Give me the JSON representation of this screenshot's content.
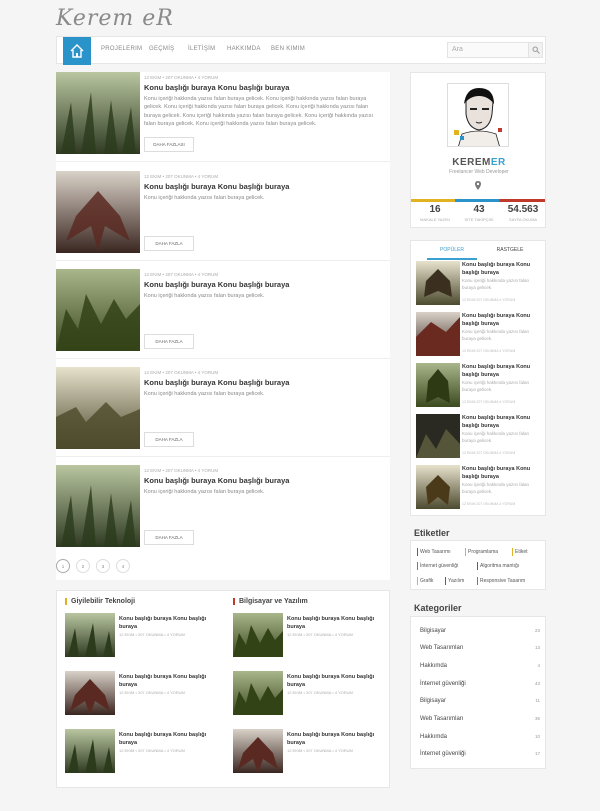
{
  "logo": "Kerem eR",
  "nav": {
    "items": [
      "PROJELERIM",
      "GEÇMİŞ",
      "İLETİŞİM",
      "HAKKIMDA",
      "BEN KIMIM"
    ],
    "search_placeholder": "Ara"
  },
  "posts": [
    {
      "meta": "12 EKIM  •  207 OKUNMA  •  4 YORUM",
      "title": "Konu başlığı buraya Konu başlığı buraya",
      "excerpt": "Konu içeriği hakkında yazısı falan buraya gelicek. Konu içeriği hakkında yazısı falan buraya gelicek. Konu içeriği hakkında yazısı falan buraya gelicek. Konu içeriği hakkında yazısı falan buraya gelicek. Konu içeriği hakkında yazısı falan buraya gelicek. Konu içeriği hakkında yazısı falan buraya gelicek. Konu içeriği hakkında yazısı falan buraya gelicek.",
      "button": "DAHA FAZLASI"
    },
    {
      "meta": "12 EKIM  •  207 OKUNMA  •  4 YORUM",
      "title": "Konu başlığı buraya Konu başlığı buraya",
      "excerpt": "Konu içeriği hakkında yazısı falan buraya gelicek.",
      "button": "DAHA FAZLA"
    },
    {
      "meta": "12 EKIM  •  207 OKUNMA  •  4 YORUM",
      "title": "Konu başlığı buraya Konu başlığı buraya",
      "excerpt": "Konu içeriği hakkında yazısı falan buraya gelicek.",
      "button": "DAHA FAZLA"
    },
    {
      "meta": "12 EKIM  •  207 OKUNMA  •  4 YORUM",
      "title": "Konu başlığı buraya Konu başlığı buraya",
      "excerpt": "Konu içeriği hakkında yazısı falan buraya gelicek.",
      "button": "DAHA FAZLA"
    },
    {
      "meta": "12 EKIM  •  207 OKUNMA  •  4 YORUM",
      "title": "Konu başlığı buraya Konu başlığı buraya",
      "excerpt": "Konu içeriği hakkında yazısı falan buraya gelicek.",
      "button": "DAHA FAZLA"
    }
  ],
  "pagination": [
    "1",
    "2",
    "3",
    "4"
  ],
  "bottom": {
    "col1": {
      "heading": "Giyilebilir Teknoloji",
      "items": [
        {
          "title": "Konu başlığı buraya Konu başlığı buraya",
          "meta": "12 EKIM • 207 OKUNMA • 4 YORUM"
        },
        {
          "title": "Konu başlığı buraya Konu başlığı buraya",
          "meta": "12 EKIM • 207 OKUNMA • 4 YORUM"
        },
        {
          "title": "Konu başlığı buraya Konu başlığı buraya",
          "meta": "12 EKIM • 207 OKUNMA • 4 YORUM"
        }
      ]
    },
    "col2": {
      "heading": "Bilgisayar ve Yazılım",
      "items": [
        {
          "title": "Konu başlığı buraya Konu başlığı buraya",
          "meta": "12 EKIM • 207 OKUNMA • 4 YORUM"
        },
        {
          "title": "Konu başlığı buraya Konu başlığı buraya",
          "meta": "12 EKIM • 207 OKUNMA • 4 YORUM"
        },
        {
          "title": "Konu başlığı buraya Konu başlığı buraya",
          "meta": "12 EKIM • 207 OKUNMA • 4 YORUM"
        }
      ]
    }
  },
  "profile": {
    "name_main": "KEREM",
    "name_hl": "ER",
    "role": "Freelancer Web Developer",
    "stats": [
      {
        "value": "16",
        "label": "MAKALE YAZISI"
      },
      {
        "value": "43",
        "label": "SITE TAKİPÇİSİ"
      },
      {
        "value": "54.563",
        "label": "SAYFA OKUMA"
      }
    ]
  },
  "tabs": {
    "labels": [
      "POPÜLER",
      "RASTGELE"
    ],
    "items": [
      {
        "title": "Konu başlığı buraya Konu başlığı buraya",
        "excerpt": "Konu içeriği hakkında yazısı falan buraya gelicek.",
        "meta": "12 EKIM   207 OKUNMA   4 YORUM"
      },
      {
        "title": "Konu başlığı buraya Konu başlığı buraya",
        "excerpt": "Konu içeriği hakkında yazısı falan buraya gelicek.",
        "meta": "12 EKIM   207 OKUNMA   4 YORUM"
      },
      {
        "title": "Konu başlığı buraya Konu başlığı buraya",
        "excerpt": "Konu içeriği hakkında yazısı falan buraya gelicek.",
        "meta": "12 EKIM   207 OKUNMA   4 YORUM"
      },
      {
        "title": "Konu başlığı buraya Konu başlığı buraya",
        "excerpt": "Konu içeriği hakkında yazısı falan buraya gelicek.",
        "meta": "12 EKIM   207 OKUNMA   4 YORUM"
      },
      {
        "title": "Konu başlığı buraya Konu başlığı buraya",
        "excerpt": "Konu içeriği hakkında yazısı falan buraya gelicek.",
        "meta": "12 EKIM   207 OKUNMA   4 YORUM"
      }
    ]
  },
  "tags": {
    "heading": "Etiketler",
    "items": [
      "Web Tasarımı",
      "Programlama",
      "Etiket",
      "İnternet güvenliği",
      "Algoritma mantığı",
      "Grafik",
      "Yazılım",
      "Responsive Tasarım"
    ]
  },
  "categories": {
    "heading": "Kategoriler",
    "items": [
      {
        "name": "Bilgisayar",
        "count": "23"
      },
      {
        "name": "Web Tasarımları",
        "count": "13"
      },
      {
        "name": "Hakkımda",
        "count": "4"
      },
      {
        "name": "İnternet güvenliği",
        "count": "43"
      },
      {
        "name": "Bilgisayar",
        "count": "11"
      },
      {
        "name": "Web Tasarımları",
        "count": "36"
      },
      {
        "name": "Hakkımda",
        "count": "10"
      },
      {
        "name": "İnternet güvenliği",
        "count": "17"
      }
    ]
  },
  "colors": {
    "accent": "#2a93c9",
    "yellow": "#e2b320",
    "red": "#c0392b"
  }
}
